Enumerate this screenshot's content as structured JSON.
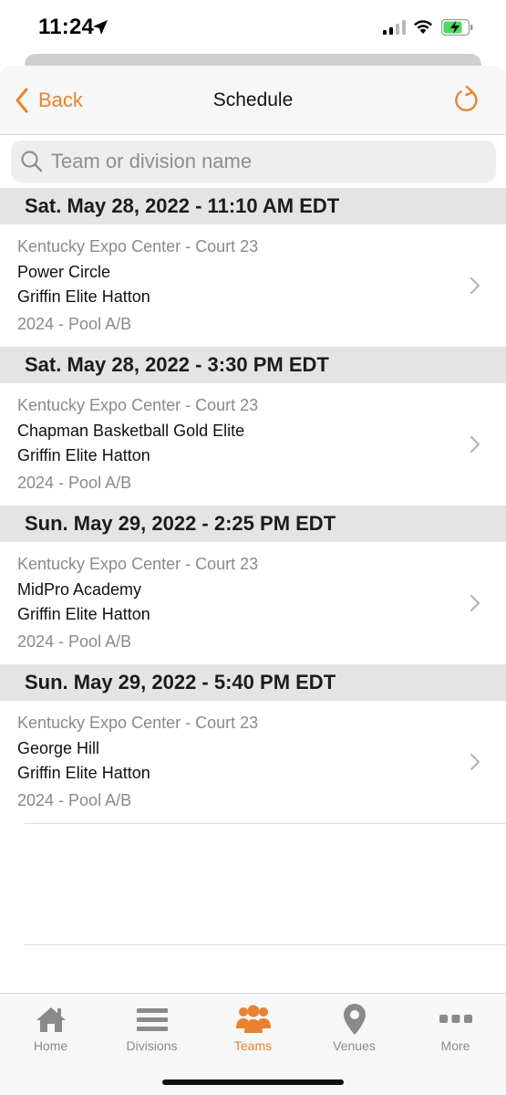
{
  "status": {
    "time": "11:24",
    "battery_color": "#4cd964"
  },
  "colors": {
    "accent": "#e8822f"
  },
  "nav": {
    "back_label": "Back",
    "title": "Schedule",
    "refresh_icon": "refresh-icon"
  },
  "search": {
    "placeholder": "Team or division name",
    "value": ""
  },
  "days": [
    {
      "header": "Sat. May 28, 2022 - 11:10 AM EDT",
      "venue": "Kentucky Expo Center - Court 23",
      "team1": "Power Circle",
      "team2": "Griffin Elite Hatton",
      "pool": "2024 - Pool A/B"
    },
    {
      "header": "Sat. May 28, 2022 - 3:30 PM EDT",
      "venue": "Kentucky Expo Center - Court 23",
      "team1": "Chapman Basketball Gold Elite",
      "team2": "Griffin Elite Hatton",
      "pool": "2024 - Pool A/B"
    },
    {
      "header": "Sun. May 29, 2022 - 2:25 PM EDT",
      "venue": "Kentucky Expo Center - Court 23",
      "team1": "MidPro Academy",
      "team2": "Griffin Elite Hatton",
      "pool": "2024 - Pool A/B"
    },
    {
      "header": "Sun. May 29, 2022 - 5:40 PM EDT",
      "venue": "Kentucky Expo Center - Court 23",
      "team1": "George Hill",
      "team2": "Griffin Elite Hatton",
      "pool": "2024 - Pool A/B"
    }
  ],
  "tabs": [
    {
      "label": "Home",
      "icon": "home-icon",
      "active": false
    },
    {
      "label": "Divisions",
      "icon": "list-icon",
      "active": false
    },
    {
      "label": "Teams",
      "icon": "people-icon",
      "active": true
    },
    {
      "label": "Venues",
      "icon": "location-pin-icon",
      "active": false
    },
    {
      "label": "More",
      "icon": "more-dots-icon",
      "active": false
    }
  ]
}
